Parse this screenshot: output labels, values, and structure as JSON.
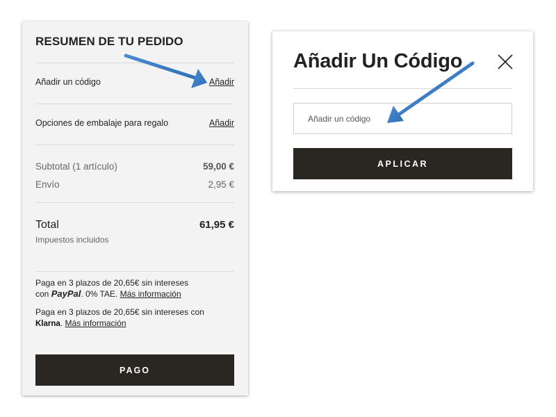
{
  "summary": {
    "title": "RESUMEN DE TU PEDIDO",
    "code_label": "Añadir un código",
    "code_link": "Añadir",
    "gift_label": "Opciones de embalaje para regalo",
    "gift_link": "Añadir",
    "subtotal_label": "Subtotal (1 artículo)",
    "subtotal_value": "59,00 €",
    "shipping_label": "Envío",
    "shipping_value": "2,95 €",
    "total_label": "Total",
    "total_value": "61,95 €",
    "taxes_note": "Impuestos incluidos",
    "paypal": {
      "line1": "Paga en 3 plazos de 20,65€ sin intereses",
      "prefix": "con",
      "logo": "PayPal",
      "suffix": ". 0% TAE.",
      "more": "Más información"
    },
    "klarna": {
      "line1": "Paga en 3 plazos de 20,65€ sin intereses con",
      "logo": "Klarna",
      "suffix": ".",
      "more": "Más información"
    },
    "checkout_button": "PAGO"
  },
  "modal": {
    "title": "Añadir Un Código",
    "input_placeholder": "Añadir un código",
    "apply_button": "APLICAR"
  },
  "icons": {
    "close": "close-icon",
    "annotation_arrow": "arrow-icon"
  },
  "colors": {
    "button_bg": "#2a2723",
    "panel_bg": "#f3f3f3",
    "arrow": "#3c7dc4"
  }
}
